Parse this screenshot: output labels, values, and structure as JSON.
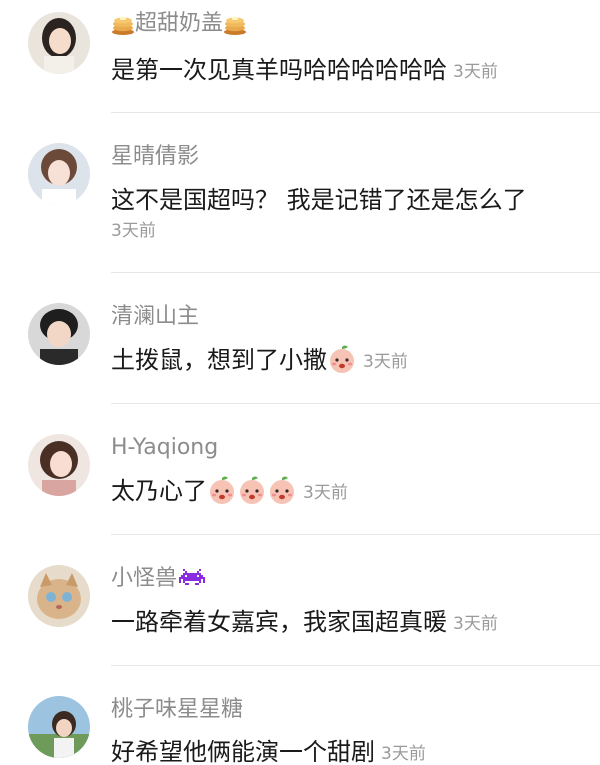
{
  "comments": [
    {
      "username": "超甜奶盖",
      "text": "是第一次见真羊吗哈哈哈哈哈哈",
      "time": "3天前",
      "name_icon": "pancake-icon"
    },
    {
      "username": "星晴倩影",
      "text": "这不是国超吗？ 我是记错了还是怎么了",
      "time": "3天前"
    },
    {
      "username": "清澜山主",
      "text": "土拨鼠，想到了小撒",
      "time": "3天前",
      "text_emoji": "peach-face-emoji"
    },
    {
      "username": "H-Yaqiong",
      "text": "太乃心了",
      "time": "3天前",
      "text_emoji": "peach-face-emoji"
    },
    {
      "username": "小怪兽",
      "text": "一路牵着女嘉宾，我家国超真暖",
      "time": "3天前",
      "name_icon": "space-invader-icon"
    },
    {
      "username": "桃子味星星糖",
      "text": "好希望他俩能演一个甜剧",
      "time": "3天前"
    }
  ],
  "colors": {
    "username": "#8c8c8c",
    "text": "#1a1a1a",
    "time": "#9a9a9a",
    "divider": "#e6e6e6",
    "invader": "#8a2be2"
  }
}
